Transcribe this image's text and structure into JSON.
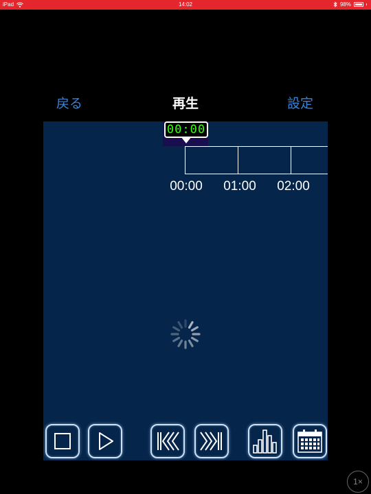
{
  "status_bar": {
    "device": "iPad",
    "time": "14:02",
    "battery": "98%",
    "battery_level": 0.98,
    "wifi_icon": "wifi-icon",
    "bluetooth_icon": "bluetooth-icon"
  },
  "nav": {
    "back_label": "戻る",
    "title": "再生",
    "settings_label": "設定"
  },
  "player": {
    "current_time": "00:00",
    "timeline_labels": [
      "00:00",
      "01:00",
      "02:00"
    ],
    "loading_icon": "loading-spinner-icon"
  },
  "controls": [
    {
      "icon": "stop-icon"
    },
    {
      "icon": "play-icon"
    },
    {
      "icon": "rewind-icon"
    },
    {
      "icon": "fast-forward-icon"
    },
    {
      "icon": "bar-chart-icon"
    },
    {
      "icon": "calendar-icon"
    }
  ],
  "zoom_badge": "1×",
  "colors": {
    "status_bar": "#e5262d",
    "nav_link": "#3b82d6",
    "panel_bg": "#05254a",
    "time_digits": "#39ff14",
    "marker_bg": "#1a0e4e"
  }
}
